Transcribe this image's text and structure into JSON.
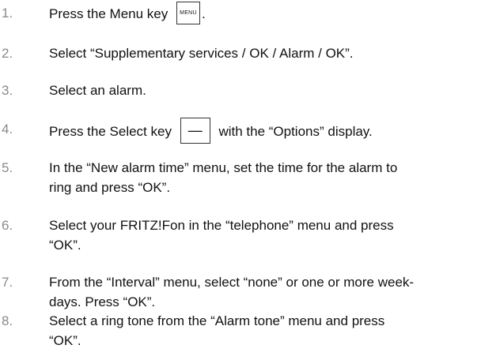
{
  "steps": [
    {
      "number": "1.",
      "text_before": "Press the Menu key",
      "key": "MENU",
      "text_after": "."
    },
    {
      "number": "2.",
      "text": "Select “Supplementary services / OK / Alarm / OK”."
    },
    {
      "number": "3.",
      "text": "Select an alarm."
    },
    {
      "number": "4.",
      "text_before": "Press the Select key",
      "key": "—",
      "text_after": "with the “Options” display."
    },
    {
      "number": "5.",
      "line1": "In the “New alarm time” menu, set the time for the alarm to",
      "line2": "ring and press “OK”."
    },
    {
      "number": "6.",
      "line1": "Select your FRITZ!Fon in the “telephone” menu and press",
      "line2": "“OK”."
    },
    {
      "number": "7.",
      "line1": "From the “Interval” menu, select “none” or one or more week-",
      "line2": "days. Press “OK”."
    },
    {
      "number": "8.",
      "line1": "Select a ring tone from the “Alarm tone” menu and press",
      "line2": "“OK”."
    }
  ]
}
